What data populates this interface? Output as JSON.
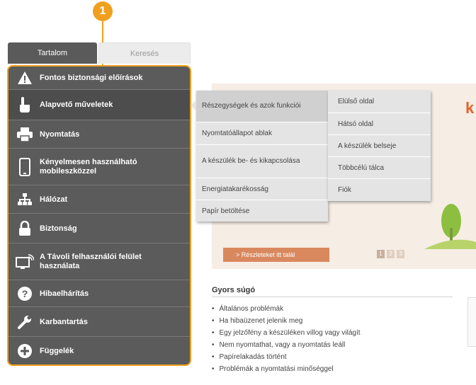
{
  "callout": {
    "number": "1"
  },
  "tabs": [
    {
      "label": "Tartalom",
      "active": true
    },
    {
      "label": "Keresés",
      "active": false
    }
  ],
  "sidebar": {
    "items": [
      {
        "label": "Fontos biztonsági előírások",
        "icon": "warning-icon"
      },
      {
        "label": "Alapvető műveletek",
        "icon": "hand-pointer-icon"
      },
      {
        "label": "Nyomtatás",
        "icon": "printer-icon"
      },
      {
        "label": "Kényelmesen használható mobileszközzel",
        "icon": "mobile-device-icon"
      },
      {
        "label": "Hálózat",
        "icon": "network-icon"
      },
      {
        "label": "Biztonság",
        "icon": "lock-icon"
      },
      {
        "label": "A Távoli felhasználói felület használata",
        "icon": "remote-ui-icon"
      },
      {
        "label": "Hibaelhárítás",
        "icon": "question-icon"
      },
      {
        "label": "Karbantartás",
        "icon": "wrench-icon"
      },
      {
        "label": "Függelék",
        "icon": "plus-icon"
      }
    ]
  },
  "submenu": {
    "items": [
      {
        "label": "Részegységek és azok funkciói"
      },
      {
        "label": "Nyomtatóállapot ablak"
      },
      {
        "label": "A készülék be- és kikapcsolása"
      },
      {
        "label": "Energiatakarékosság"
      },
      {
        "label": "Papír betöltése"
      }
    ]
  },
  "submenu2": {
    "items": [
      {
        "label": "Elülső oldal"
      },
      {
        "label": "Hátsó oldal"
      },
      {
        "label": "A készülék belseje"
      },
      {
        "label": "Többcélú tálca"
      },
      {
        "label": "Fiók"
      }
    ]
  },
  "banner": {
    "button_label": "> Részleteket itt talál",
    "pages": [
      "1",
      "2",
      "3"
    ]
  },
  "help": {
    "title": "Gyors súgó",
    "items": [
      "Általános problémák",
      "Ha hibaüzenet jelenik meg",
      "Egy jelzőfény a készüléken villog vagy világít",
      "Nem nyomtathat, vagy a nyomtatás leáll",
      "Papírelakadás történt",
      "Problémák a nyomtatási minőséggel"
    ]
  },
  "colors": {
    "accent": "#f0a020",
    "sidebar_bg": "#5b5b5b",
    "banner_btn": "#d9885e"
  }
}
